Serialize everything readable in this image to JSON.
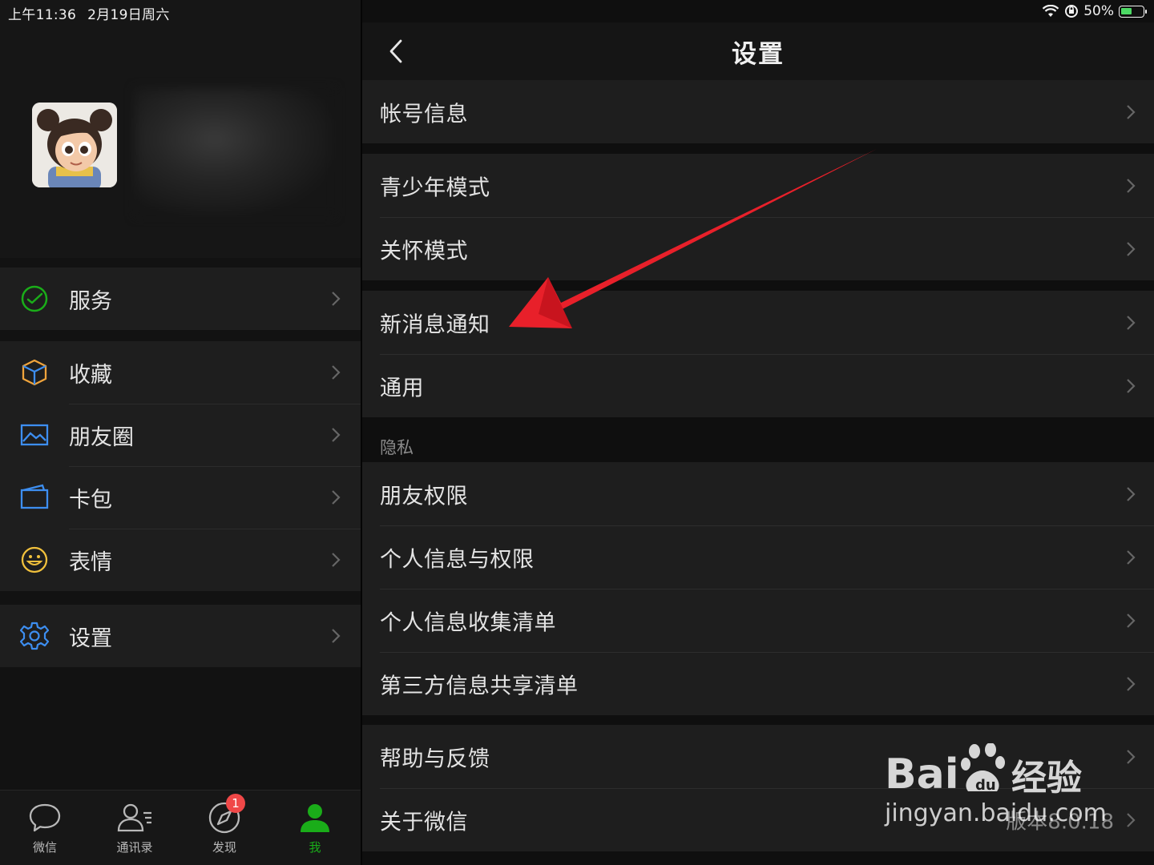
{
  "status_bar": {
    "time": "上午11:36",
    "date": "2月19日周六",
    "battery": "50%",
    "battery_level": 0.5
  },
  "sidebar": {
    "groups": [
      {
        "items": [
          {
            "label": "服务",
            "icon": "service-icon",
            "color": "#1aad19"
          }
        ]
      },
      {
        "items": [
          {
            "label": "收藏",
            "icon": "favorites-cube-icon",
            "color": "#f0a43c"
          },
          {
            "label": "朋友圈",
            "icon": "moments-image-icon",
            "color": "#3d8ef0"
          },
          {
            "label": "卡包",
            "icon": "card-wallet-icon",
            "color": "#3d8ef0"
          },
          {
            "label": "表情",
            "icon": "sticker-smile-icon",
            "color": "#f0c03c"
          }
        ]
      },
      {
        "items": [
          {
            "label": "设置",
            "icon": "settings-gear-icon",
            "color": "#3d8ef0"
          }
        ]
      }
    ]
  },
  "tabbar": {
    "tabs": [
      {
        "label": "微信",
        "icon": "chat-bubble-icon"
      },
      {
        "label": "通讯录",
        "icon": "contacts-icon"
      },
      {
        "label": "发现",
        "icon": "discover-compass-icon",
        "badge": "1"
      },
      {
        "label": "我",
        "icon": "me-person-icon",
        "active": true
      }
    ],
    "active_color": "#1aad19"
  },
  "settings": {
    "title": "设置",
    "groups": [
      {
        "items": [
          {
            "label": "帐号信息"
          }
        ]
      },
      {
        "items": [
          {
            "label": "青少年模式"
          },
          {
            "label": "关怀模式"
          }
        ]
      },
      {
        "items": [
          {
            "label": "新消息通知"
          },
          {
            "label": "通用"
          }
        ]
      },
      {
        "section": "隐私",
        "items": [
          {
            "label": "朋友权限"
          },
          {
            "label": "个人信息与权限"
          },
          {
            "label": "个人信息收集清单"
          },
          {
            "label": "第三方信息共享清单"
          }
        ]
      },
      {
        "items": [
          {
            "label": "帮助与反馈"
          },
          {
            "label": "关于微信",
            "value": "版本8.0.18"
          }
        ]
      }
    ]
  },
  "watermark": {
    "logo": "Bai du 经验",
    "url": "jingyan.baidu.com"
  },
  "annotation_color": "#e8202a"
}
